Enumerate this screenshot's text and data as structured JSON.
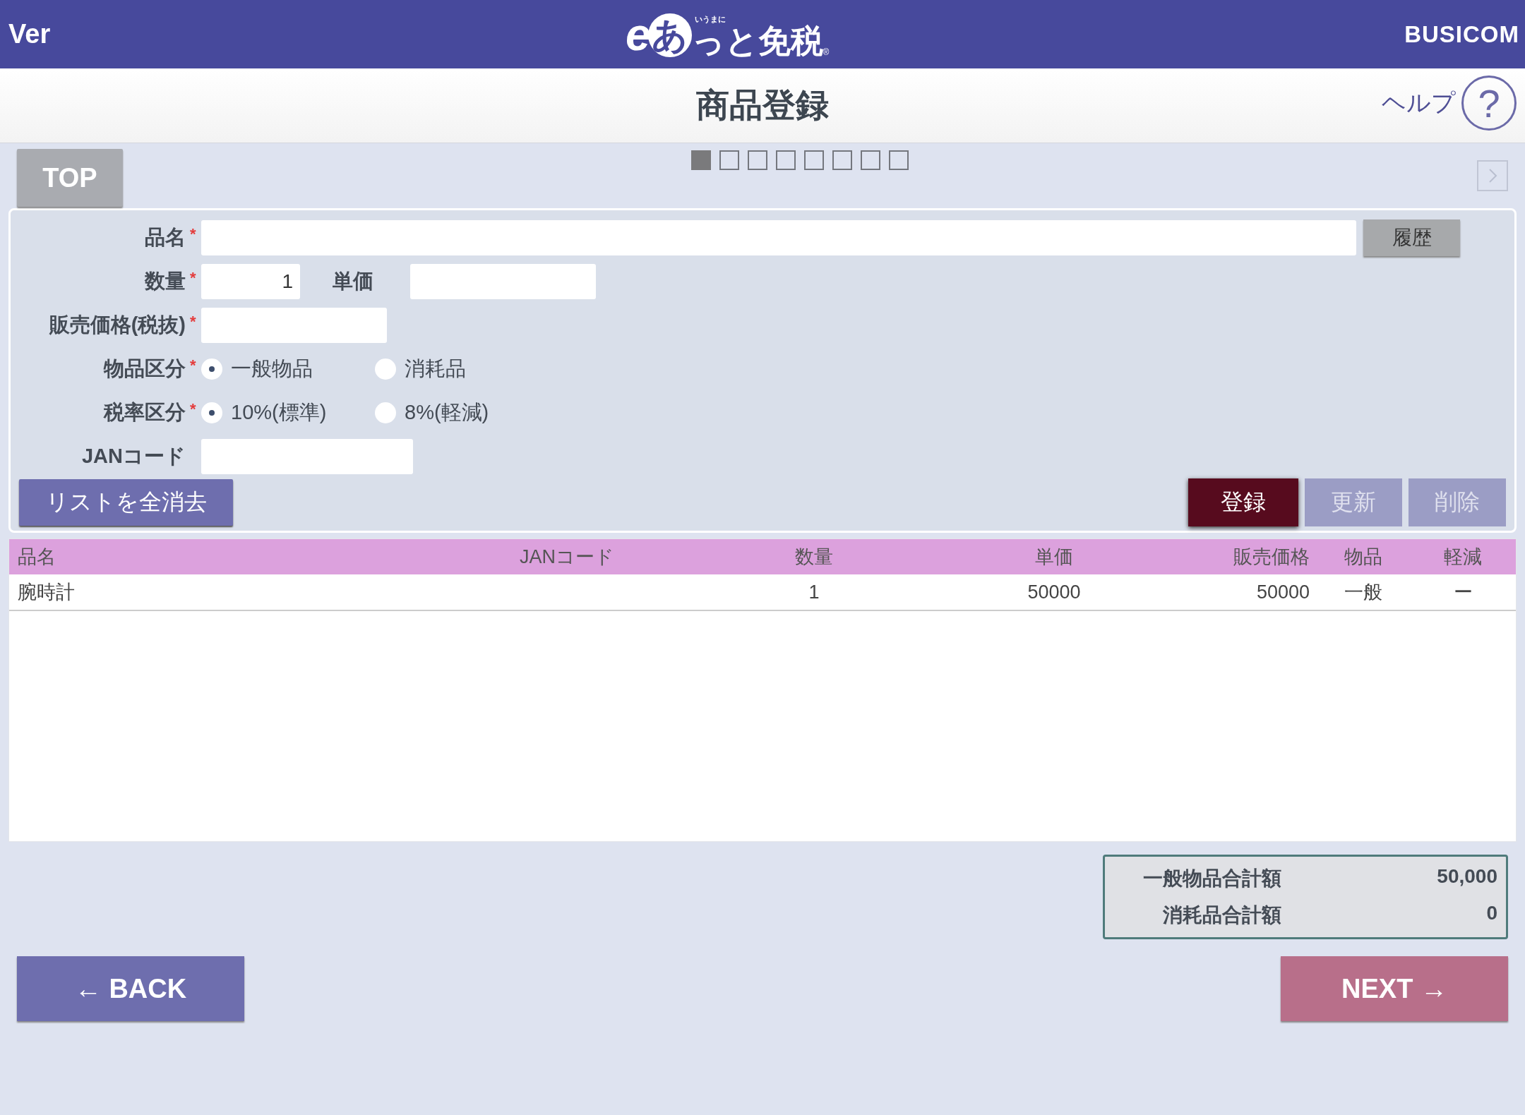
{
  "header": {
    "version_label": "Ver",
    "logo": {
      "e": "e",
      "a": "あ",
      "small": "いうまに",
      "rest": "っと免税",
      "mark": "®"
    },
    "brand": "BUSICOM"
  },
  "title_bar": {
    "title": "商品登録",
    "help": "ヘルプ",
    "help_icon": "?"
  },
  "top_button": "TOP",
  "steps": [
    {
      "selected": true
    },
    {
      "selected": false
    },
    {
      "selected": false
    },
    {
      "selected": false
    },
    {
      "selected": false
    },
    {
      "selected": false
    },
    {
      "selected": false
    },
    {
      "selected": false
    }
  ],
  "form": {
    "name": {
      "label": "品名",
      "required_mark": "*"
    },
    "history_button": "履歴",
    "quantity": {
      "label": "数量",
      "required_mark": "*",
      "value": "1"
    },
    "unit_price": {
      "label": "単価"
    },
    "sale_price": {
      "label": "販売価格(税抜)",
      "required_mark": "*"
    },
    "item_category": {
      "label": "物品区分",
      "required_mark": "*",
      "options": [
        {
          "label": "一般物品",
          "selected": true
        },
        {
          "label": "消耗品",
          "selected": false
        }
      ]
    },
    "tax_category": {
      "label": "税率区分",
      "required_mark": "*",
      "options": [
        {
          "label": "10%(標準)",
          "selected": true
        },
        {
          "label": "8%(軽減)",
          "selected": false
        }
      ]
    },
    "jan_code": {
      "label": "JANコード"
    },
    "clear_button": "リストを全消去",
    "actions": [
      {
        "label": "登録",
        "kind": "primary",
        "disabled": false
      },
      {
        "label": "更新",
        "kind": "secondary",
        "disabled": true
      },
      {
        "label": "削除",
        "kind": "secondary",
        "disabled": true
      }
    ]
  },
  "table": {
    "columns": [
      "品名",
      "JANコード",
      "数量",
      "単価",
      "販売価格",
      "物品",
      "軽減"
    ],
    "rows": [
      [
        "腕時計",
        "",
        "1",
        "50000",
        "50000",
        "一般",
        "ー"
      ]
    ]
  },
  "totals": [
    {
      "label": "一般物品合計額",
      "value": "50,000"
    },
    {
      "label": "消耗品合計額",
      "value": "0"
    }
  ],
  "back_button": "← BACK",
  "next_button": "NEXT →"
}
